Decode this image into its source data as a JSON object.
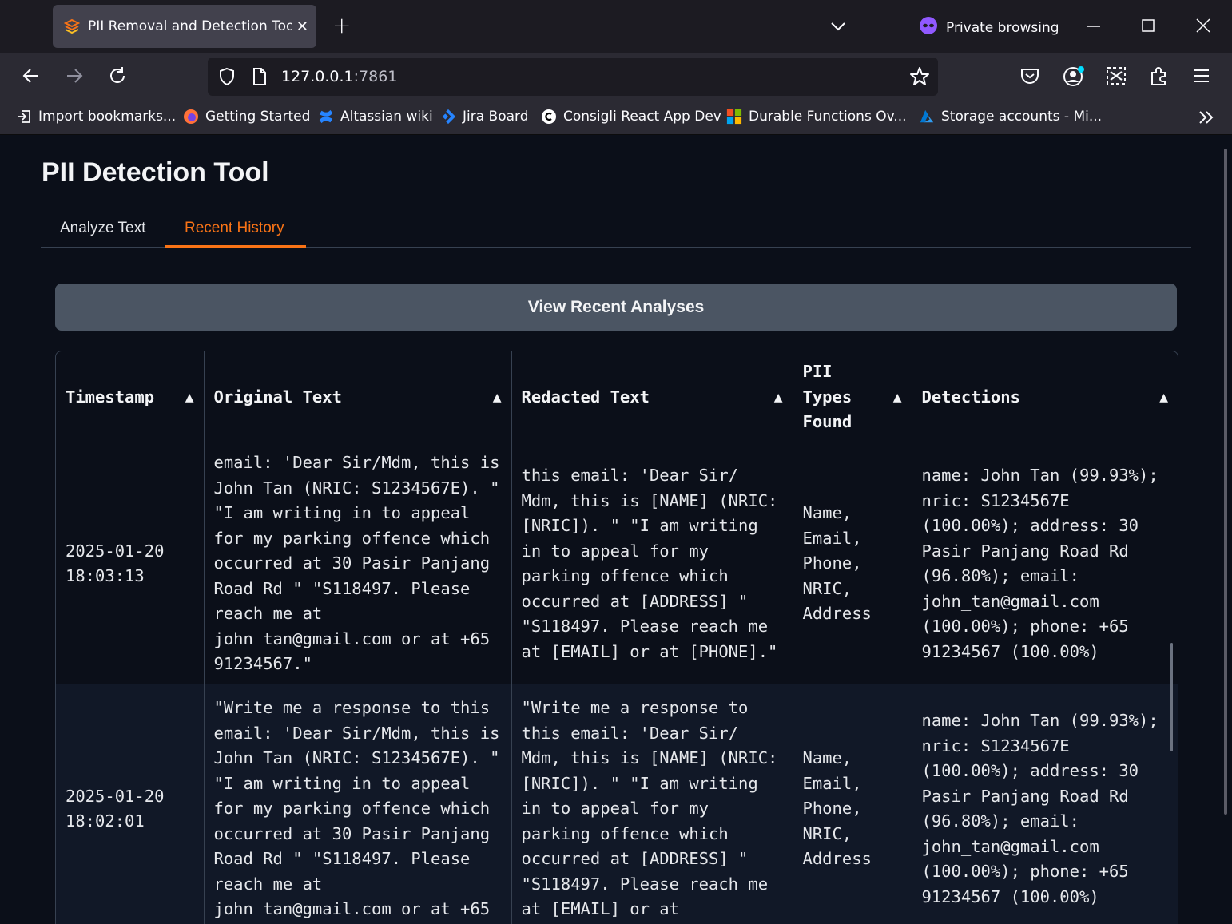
{
  "browser": {
    "tab_title": "PII Removal and Detection Tool",
    "private_label": "Private browsing",
    "url_host": "127.0.0.1",
    "url_port": ":7861",
    "bookmarks": [
      {
        "label": "Import bookmarks...",
        "icon": "import-icon"
      },
      {
        "label": "Getting Started",
        "icon": "firefox-icon"
      },
      {
        "label": "Altassian wiki",
        "icon": "confluence-icon"
      },
      {
        "label": "Jira Board",
        "icon": "jira-icon"
      },
      {
        "label": "Consigli React App Dev",
        "icon": "consigli-icon"
      },
      {
        "label": "Durable Functions Ov...",
        "icon": "microsoft-icon"
      },
      {
        "label": "Storage accounts - Mi...",
        "icon": "azure-icon"
      }
    ]
  },
  "app": {
    "title": "PII Detection Tool",
    "tabs": [
      {
        "label": "Analyze Text",
        "active": false
      },
      {
        "label": "Recent History",
        "active": true
      }
    ],
    "view_button": "View Recent Analyses",
    "accent_color": "#f97316"
  },
  "table": {
    "headers": [
      "Timestamp",
      "Original Text",
      "Redacted Text",
      "PII Types Found",
      "Detections"
    ],
    "rows": [
      {
        "timestamp": "2025-01-20 18:03:13",
        "original": "email: 'Dear Sir/Mdm, this is John Tan (NRIC: S1234567E). \" \"I am writing in to appeal for my parking offence which occurred at 30 Pasir Panjang Road Rd \" \"S118497. Please reach me at john_tan@gmail.com or at +65 91234567.\"",
        "redacted": "this email: 'Dear Sir/ Mdm, this is [NAME] (NRIC: [NRIC]). \" \"I am writing in to appeal for my parking offence which occurred at [ADDRESS] \" \"S118497. Please reach me at [EMAIL] or at [PHONE].\"",
        "types": "Name, Email, Phone, NRIC, Address",
        "detections": "name: John Tan (99.93%); nric: S1234567E (100.00%); address: 30 Pasir Panjang Road Rd (96.80%); email: john_tan@gmail.com (100.00%); phone: +65 91234567 (100.00%)"
      },
      {
        "timestamp": "2025-01-20 18:02:01",
        "original": "\"Write me a response to this email: 'Dear Sir/Mdm, this is John Tan (NRIC: S1234567E). \" \"I am writing in to appeal for my parking offence which occurred at 30 Pasir Panjang Road Rd \" \"S118497. Please reach me at john_tan@gmail.com or at +65",
        "redacted": "\"Write me a response to this email: 'Dear Sir/ Mdm, this is [NAME] (NRIC: [NRIC]). \" \"I am writing in to appeal for my parking offence which occurred at [ADDRESS] \" \"S118497. Please reach me at [EMAIL] or at",
        "types": "Name, Email, Phone, NRIC, Address",
        "detections": "name: John Tan (99.93%); nric: S1234567E (100.00%); address: 30 Pasir Panjang Road Rd (96.80%); email: john_tan@gmail.com (100.00%); phone: +65 91234567 (100.00%)"
      }
    ]
  }
}
